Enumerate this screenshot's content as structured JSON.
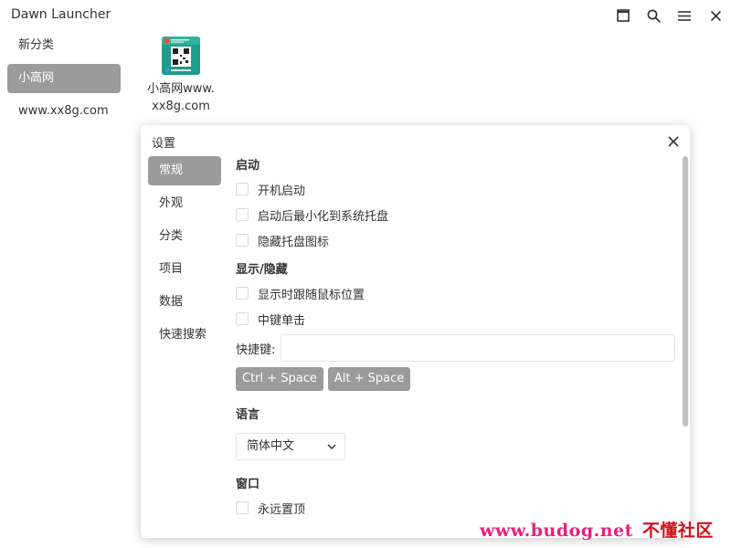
{
  "app": {
    "title": "Dawn Launcher",
    "buttons": {
      "maximize_icon": "maximize-icon",
      "search_icon": "search-icon",
      "menu_icon": "menu-icon",
      "close_icon": "close-icon"
    }
  },
  "categories": [
    {
      "label": "新分类",
      "active": false
    },
    {
      "label": "小高网",
      "active": true
    },
    {
      "label": "www.xx8g.com",
      "active": false
    }
  ],
  "items": [
    {
      "label_line1": "小高网www.",
      "label_line2": "xx8g.com",
      "icon": "qr-code-thumbnail-icon"
    }
  ],
  "settings": {
    "title": "设置",
    "nav": [
      {
        "label": "常规",
        "active": true
      },
      {
        "label": "外观",
        "active": false
      },
      {
        "label": "分类",
        "active": false
      },
      {
        "label": "项目",
        "active": false
      },
      {
        "label": "数据",
        "active": false
      },
      {
        "label": "快速搜索",
        "active": false
      }
    ],
    "startup": {
      "title": "启动",
      "options": [
        {
          "label": "开机启动",
          "checked": false
        },
        {
          "label": "启动后最小化到系统托盘",
          "checked": false
        },
        {
          "label": "隐藏托盘图标",
          "checked": false
        }
      ]
    },
    "show_hide": {
      "title": "显示/隐藏",
      "options": [
        {
          "label": "显示时跟随鼠标位置",
          "checked": false
        },
        {
          "label": "中键单击",
          "checked": false
        }
      ],
      "hotkey_label": "快捷键:",
      "hotkey_value": "",
      "hotkey_suggestions": [
        "Ctrl + Space",
        "Alt + Space"
      ]
    },
    "language": {
      "title": "语言",
      "selected": "简体中文"
    },
    "window": {
      "title": "窗口",
      "options": [
        {
          "label": "永远置顶",
          "checked": false
        }
      ]
    }
  },
  "watermark": {
    "text": "www.budog.net",
    "text_cn": "不懂社区"
  },
  "colors": {
    "active_bg": "#9b9b9b",
    "active_text": "#ffffff",
    "text": "#333333",
    "checkbox_border": "#d9d9d9",
    "scrollbar": "#c1c1c1",
    "watermark": "#e8217c"
  }
}
